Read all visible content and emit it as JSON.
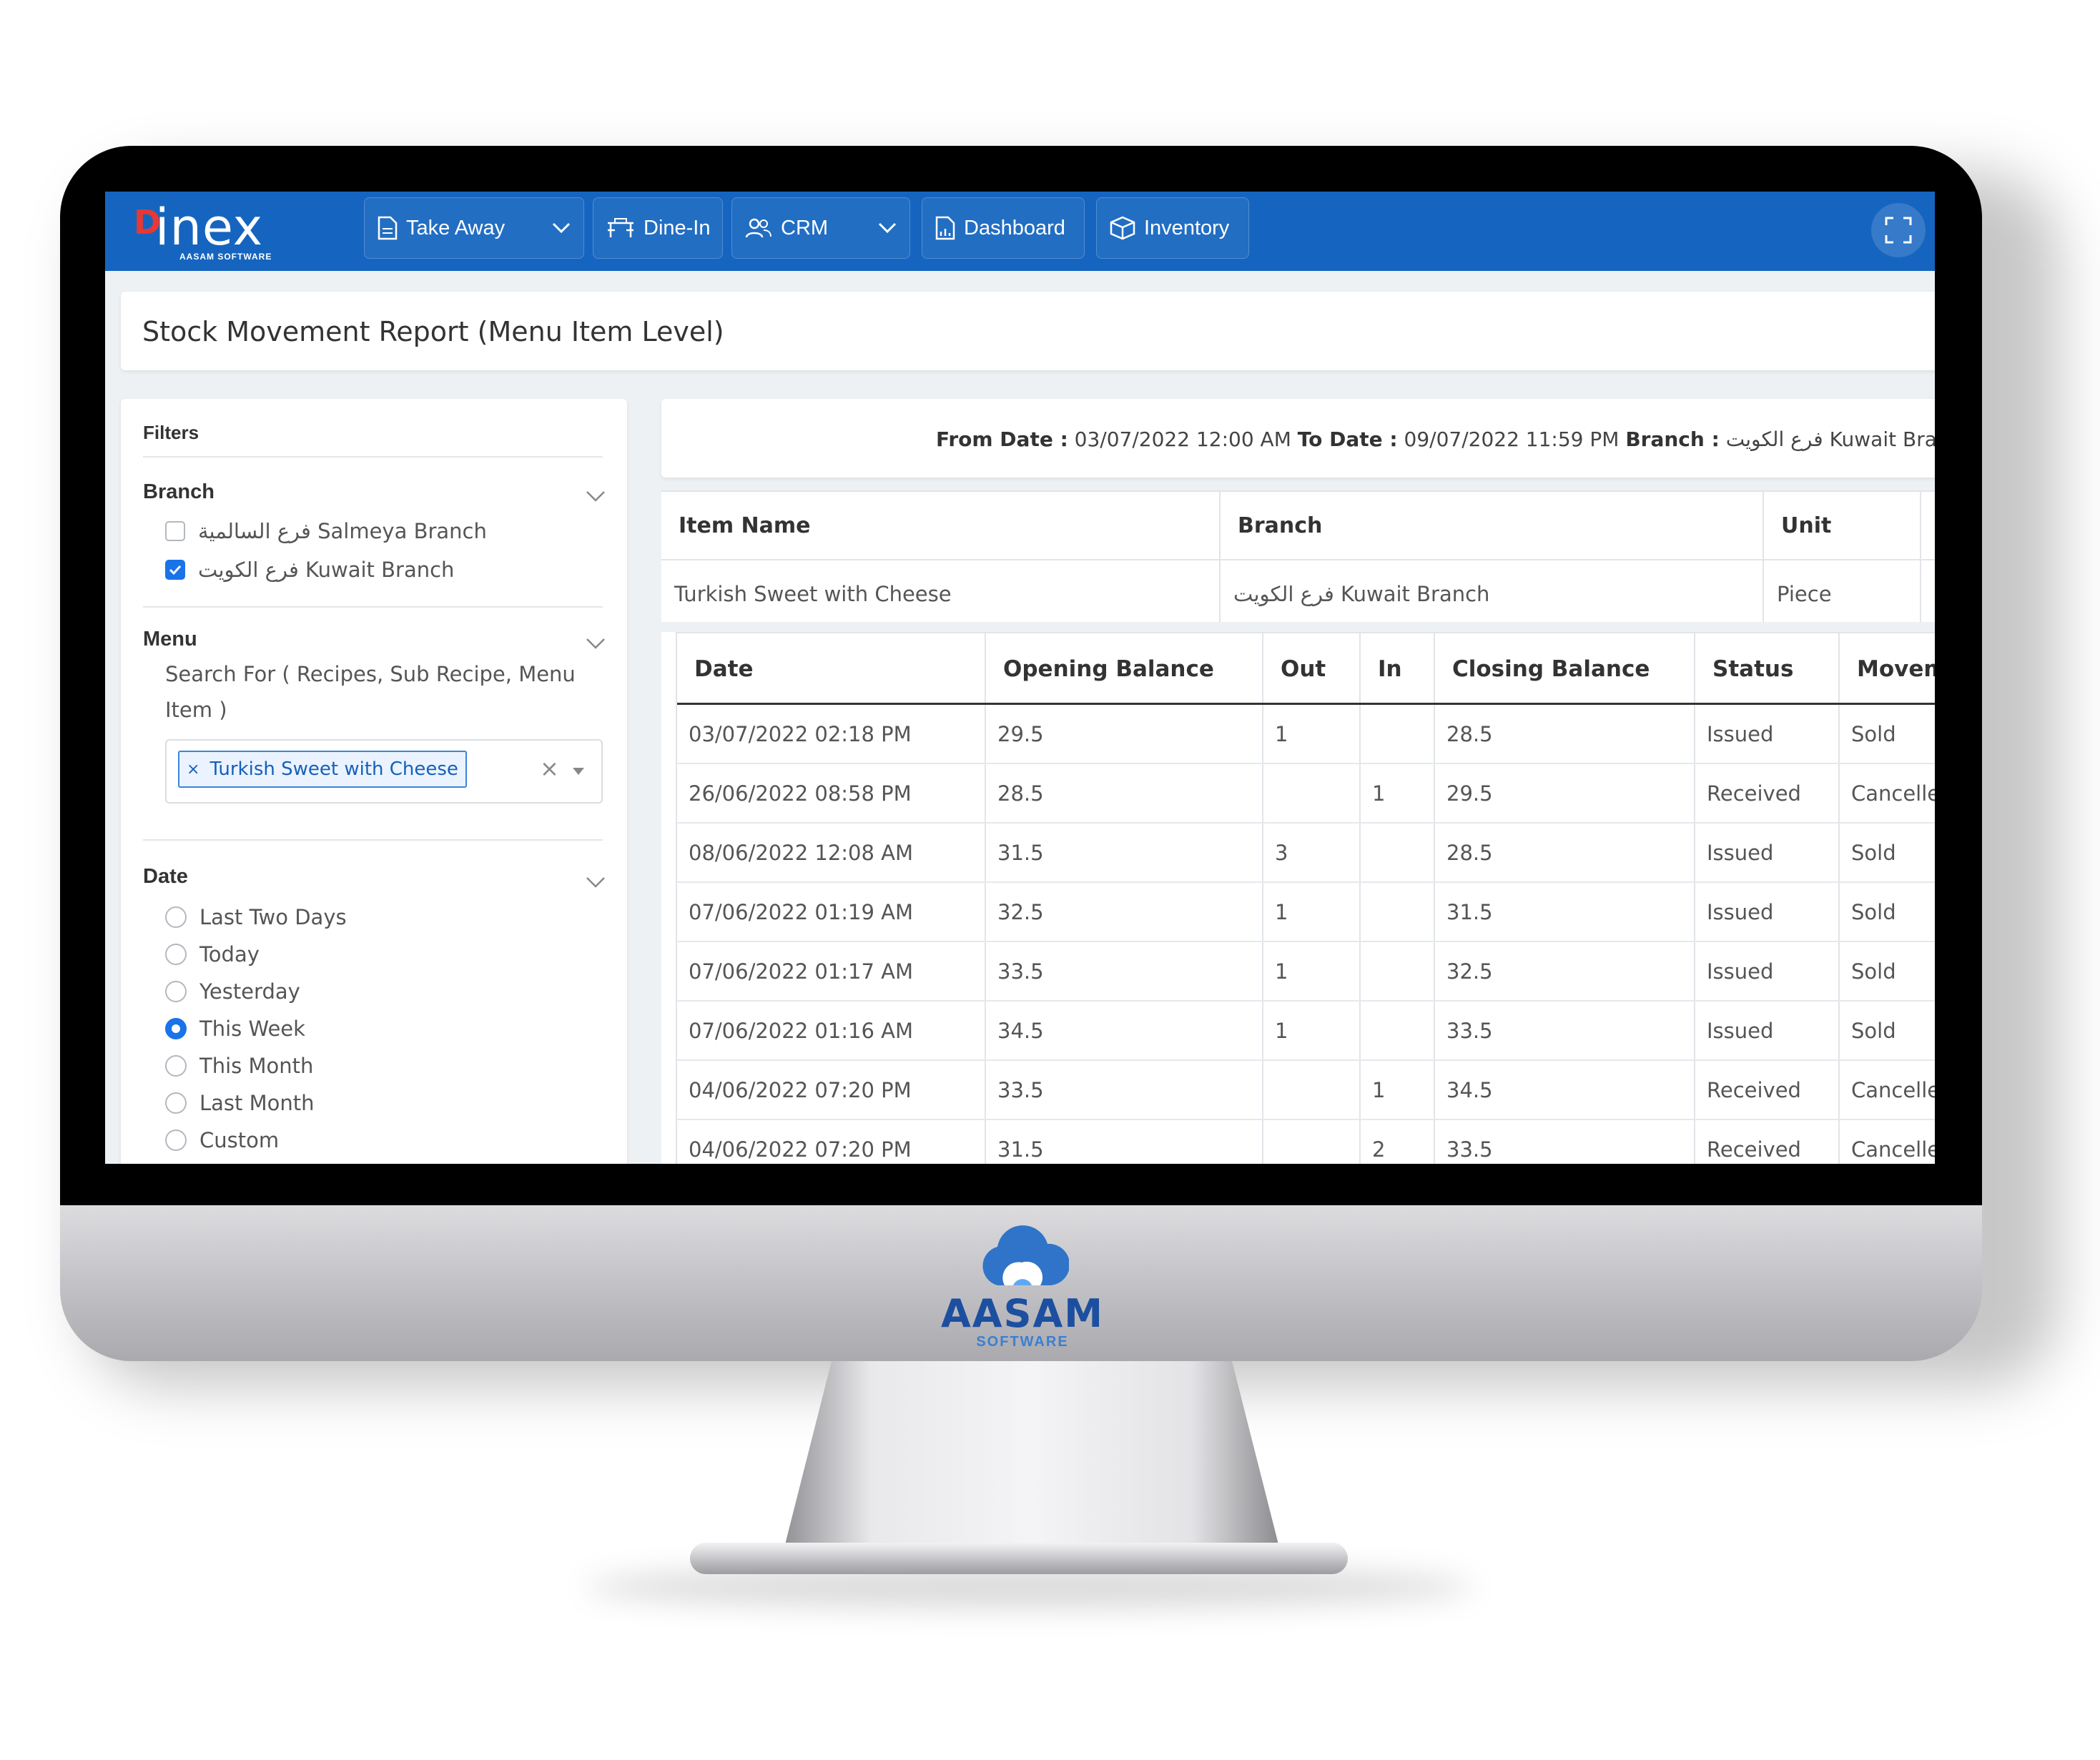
{
  "navbar": {
    "brand": {
      "mark": "D",
      "word": "inex",
      "sub": "AASAM SOFTWARE"
    },
    "items": [
      {
        "label": "Take Away",
        "icon": "document-icon",
        "has_dropdown": true
      },
      {
        "label": "Dine-In",
        "icon": "table-icon",
        "has_dropdown": false
      },
      {
        "label": "CRM",
        "icon": "users-icon",
        "has_dropdown": true
      },
      {
        "label": "Dashboard",
        "icon": "chart-icon",
        "has_dropdown": false
      },
      {
        "label": "Inventory",
        "icon": "box-icon",
        "has_dropdown": false
      }
    ]
  },
  "page": {
    "title": "Stock Movement Report (Menu Item Level)"
  },
  "filters": {
    "header": "Filters",
    "branch": {
      "title": "Branch",
      "options": [
        {
          "label": "فرع السالمية Salmeya Branch",
          "checked": false
        },
        {
          "label": "فرع الكويت Kuwait Branch",
          "checked": true
        }
      ]
    },
    "menu": {
      "title": "Menu",
      "search_label": "Search For ( Recipes, Sub Recipe, Menu Item )",
      "selected_chip": "Turkish Sweet with Cheese",
      "chip_remove": "×",
      "clear": "×"
    },
    "date": {
      "title": "Date",
      "options": [
        {
          "label": "Last Two Days",
          "selected": false
        },
        {
          "label": "Today",
          "selected": false
        },
        {
          "label": "Yesterday",
          "selected": false
        },
        {
          "label": "This Week",
          "selected": true
        },
        {
          "label": "This Month",
          "selected": false
        },
        {
          "label": "Last Month",
          "selected": false
        },
        {
          "label": "Custom",
          "selected": false
        }
      ]
    }
  },
  "report_meta": {
    "from_label": "From Date :",
    "from_value": "03/07/2022 12:00 AM",
    "to_label": "To Date :",
    "to_value": "09/07/2022 11:59 PM",
    "branch_label": "Branch :",
    "branch_value": "فرع الكويت Kuwait Bra"
  },
  "summary": {
    "headers": [
      "Item Name",
      "Branch",
      "Unit"
    ],
    "values": [
      "Turkish Sweet with Cheese",
      "فرع الكويت Kuwait Branch",
      "Piece"
    ]
  },
  "movements": {
    "headers": [
      "Date",
      "Opening Balance",
      "Out",
      "In",
      "Closing Balance",
      "Status",
      "Movem"
    ],
    "rows": [
      [
        "03/07/2022 02:18 PM",
        "29.5",
        "1",
        "",
        "28.5",
        "Issued",
        "Sold"
      ],
      [
        "26/06/2022 08:58 PM",
        "28.5",
        "",
        "1",
        "29.5",
        "Received",
        "Cancelle"
      ],
      [
        "08/06/2022 12:08 AM",
        "31.5",
        "3",
        "",
        "28.5",
        "Issued",
        "Sold"
      ],
      [
        "07/06/2022 01:19 AM",
        "32.5",
        "1",
        "",
        "31.5",
        "Issued",
        "Sold"
      ],
      [
        "07/06/2022 01:17 AM",
        "33.5",
        "1",
        "",
        "32.5",
        "Issued",
        "Sold"
      ],
      [
        "07/06/2022 01:16 AM",
        "34.5",
        "1",
        "",
        "33.5",
        "Issued",
        "Sold"
      ],
      [
        "04/06/2022 07:20 PM",
        "33.5",
        "",
        "1",
        "34.5",
        "Received",
        "Cancelle"
      ],
      [
        "04/06/2022 07:20 PM",
        "31.5",
        "",
        "2",
        "33.5",
        "Received",
        "Cancelle"
      ]
    ]
  },
  "monitor": {
    "logo_word": "AASAM",
    "logo_sub": "SOFTWARE"
  },
  "colors": {
    "navbar": "#1565c0",
    "accent": "#1a73e8",
    "brand_mark": "#e53935",
    "logo": "#1c4fa0"
  }
}
